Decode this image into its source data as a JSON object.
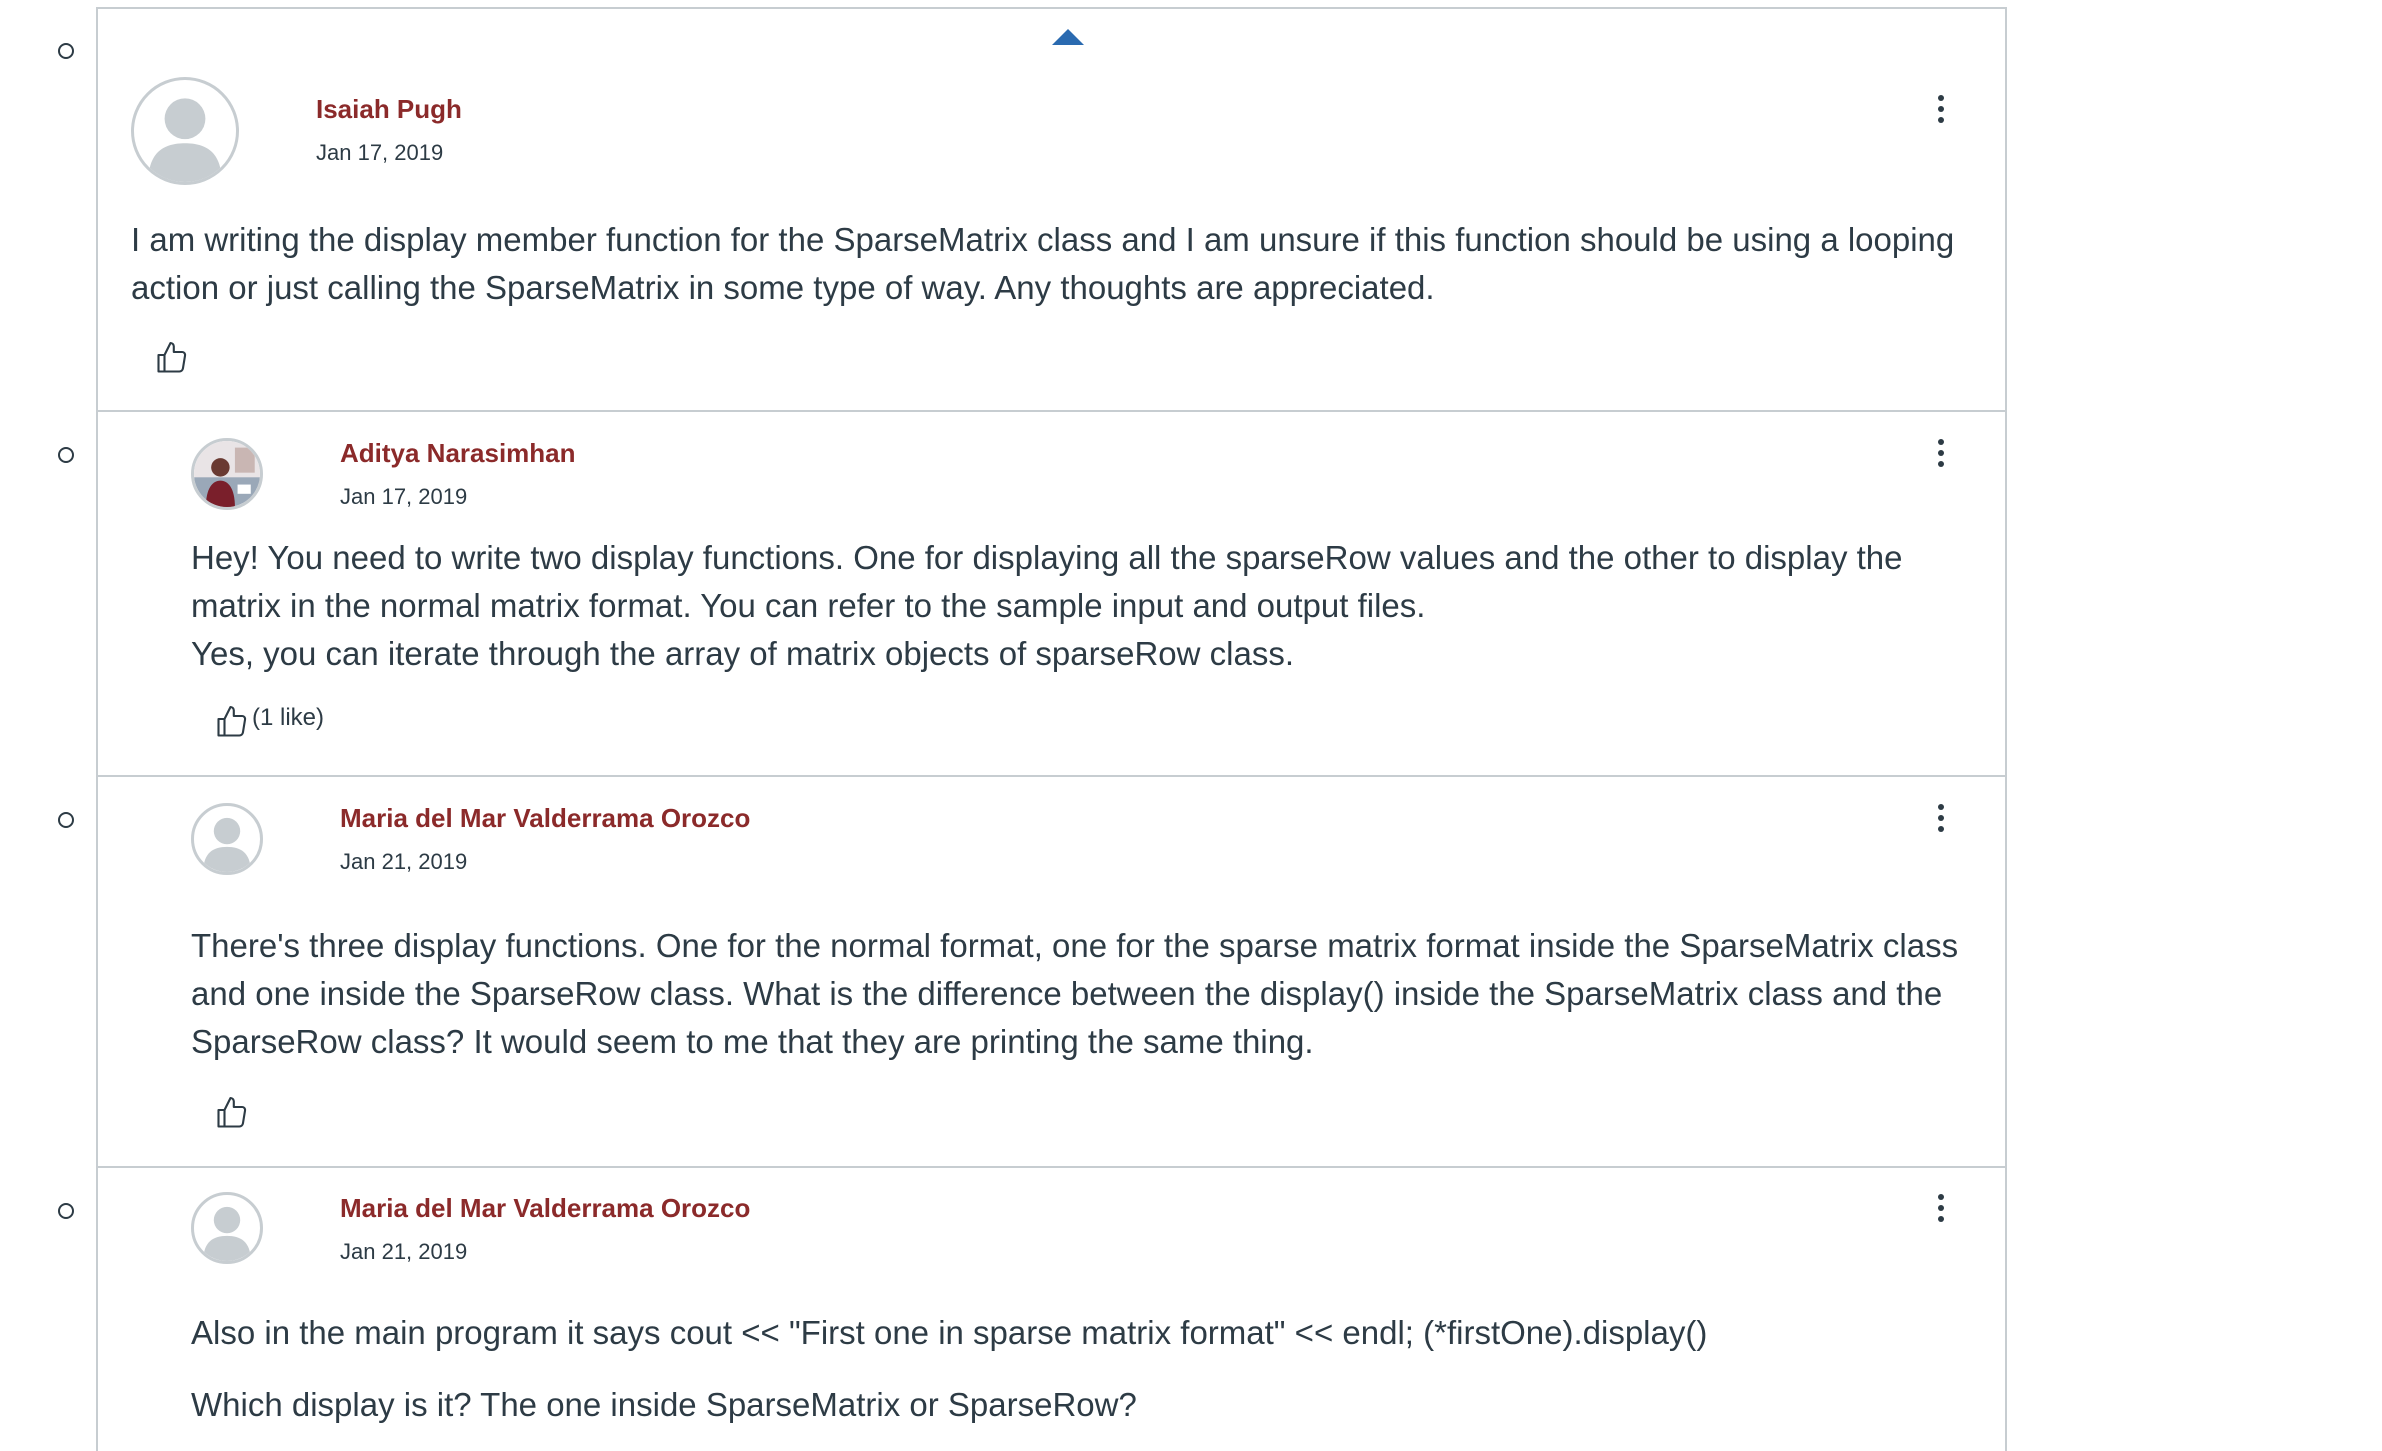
{
  "posts": [
    {
      "author": "Isaiah Pugh",
      "date": "Jan 17, 2019",
      "avatar_icon": "default-person-avatar",
      "message": [
        "I am writing the display member function for the SparseMatrix class and I am unsure if this function should be using a looping action or just calling the SparseMatrix in some type of way. Any thoughts are appreciated."
      ],
      "like_count": ""
    },
    {
      "author": "Aditya Narasimhan",
      "date": "Jan 17, 2019",
      "avatar_icon": "user-photo-avatar",
      "message": [
        "Hey! You need to write two display functions. One for displaying all the sparseRow values and the other to display the matrix in the normal matrix format. You can refer to the sample input and output files.",
        "Yes, you can iterate through the array of matrix objects of sparseRow class."
      ],
      "like_count": "(1 like)"
    },
    {
      "author": "Maria del Mar Valderrama Orozco",
      "date": "Jan 21, 2019",
      "avatar_icon": "default-person-avatar",
      "message": [
        "There's three display functions. One for the normal format, one for the sparse matrix format inside the SparseMatrix class and one inside the SparseRow class. What is the difference between the display() inside the SparseMatrix class and the SparseRow class? It would seem to me that they are printing the same thing."
      ],
      "like_count": ""
    },
    {
      "author": "Maria del Mar Valderrama Orozco",
      "date": "Jan 21, 2019",
      "avatar_icon": "default-person-avatar",
      "message": [
        "Also in the main program it says cout << \"First one in sparse matrix format\" << endl; (*firstOne).display()",
        "Which display is it? The one inside SparseMatrix or SparseRow?"
      ],
      "like_count": ""
    }
  ],
  "colors": {
    "author_link": "#8b2a2a",
    "text": "#2d3b45",
    "border": "#c7cdd1",
    "caret": "#2a6ab0"
  }
}
